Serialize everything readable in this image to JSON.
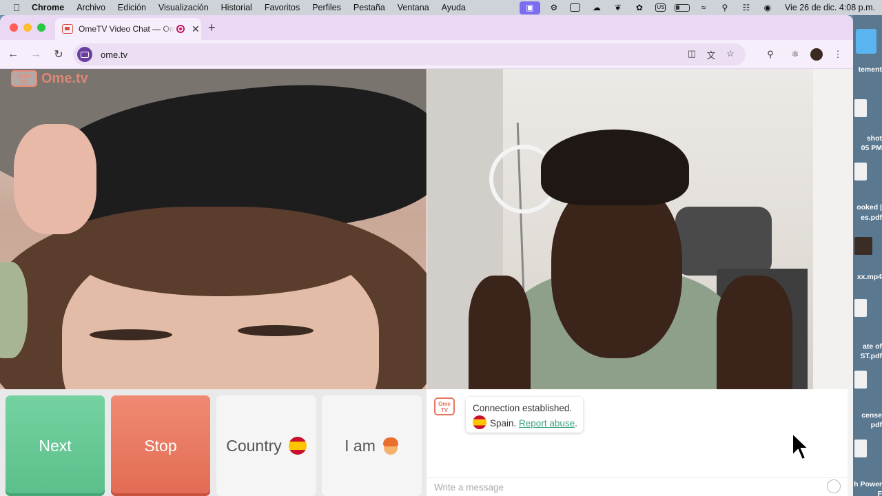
{
  "menubar": {
    "app": "Chrome",
    "items": [
      "Archivo",
      "Edición",
      "Visualización",
      "Historial",
      "Favoritos",
      "Perfiles",
      "Pestaña",
      "Ventana",
      "Ayuda"
    ],
    "keyboard_layout": "US",
    "clock": "Vie 26 de dic.  4:08 p.m."
  },
  "desktop": {
    "labels": [
      "tement",
      "shot",
      "05 PM",
      "ooked |",
      "es.pdf",
      "xx.mp4",
      "ate of",
      "ST.pdf",
      "cense",
      "pdf",
      "h Power",
      "F"
    ]
  },
  "browser": {
    "tab_title": "OmeTV Video Chat — Omegle alternative",
    "new_tab": "+",
    "url": "ome.tv"
  },
  "site": {
    "logo_box": "Ome\nTV",
    "logo_text": "Ome.tv"
  },
  "controls": {
    "next_label": "Next",
    "stop_label": "Stop",
    "country_label": "Country",
    "iam_label": "I am"
  },
  "chat": {
    "avatar_text": "Ome\nTV",
    "status_line": "Connection established.",
    "country": "Spain.",
    "report_link": "Report abuse",
    "report_suffix": ".",
    "input_placeholder": "Write a message"
  },
  "colors": {
    "next": "#5bbf8b",
    "stop": "#e26b54",
    "brand": "#ef8a78",
    "link": "#3aa37a"
  }
}
